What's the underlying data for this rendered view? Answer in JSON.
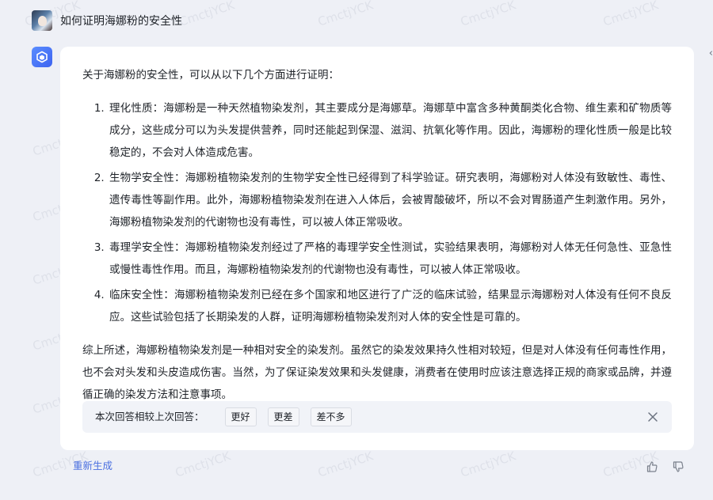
{
  "watermark": "CmctjYCK",
  "user": {
    "question": "如何证明海娜粉的安全性"
  },
  "answer": {
    "intro": "关于海娜粉的安全性，可以从以下几个方面进行证明：",
    "points": [
      "理化性质：海娜粉是一种天然植物染发剂，其主要成分是海娜草。海娜草中富含多种黄酮类化合物、维生素和矿物质等成分，这些成分可以为头发提供营养，同时还能起到保湿、滋润、抗氧化等作用。因此，海娜粉的理化性质一般是比较稳定的，不会对人体造成危害。",
      "生物学安全性：海娜粉植物染发剂的生物学安全性已经得到了科学验证。研究表明，海娜粉对人体没有致敏性、毒性、遗传毒性等副作用。此外，海娜粉植物染发剂在进入人体后，会被胃酸破坏，所以不会对胃肠道产生刺激作用。另外，海娜粉植物染发剂的代谢物也没有毒性，可以被人体正常吸收。",
      "毒理学安全性：海娜粉植物染发剂经过了严格的毒理学安全性测试，实验结果表明，海娜粉对人体无任何急性、亚急性或慢性毒性作用。而且，海娜粉植物染发剂的代谢物也没有毒性，可以被人体正常吸收。",
      "临床安全性：海娜粉植物染发剂已经在多个国家和地区进行了广泛的临床试验，结果显示海娜粉对人体没有任何不良反应。这些试验包括了长期染发的人群，证明海娜粉植物染发剂对人体的安全性是可靠的。"
    ],
    "summary": "综上所述，海娜粉植物染发剂是一种相对安全的染发剂。虽然它的染发效果持久性相对较短，但是对人体没有任何毒性作用，也不会对头发和头皮造成伤害。当然，为了保证染发效果和头发健康，消费者在使用时应该注意选择正规的商家或品牌，并遵循正确的染发方法和注意事项。"
  },
  "feedback": {
    "prompt": "本次回答相较上次回答：",
    "options": [
      "更好",
      "更差",
      "差不多"
    ]
  },
  "actions": {
    "regenerate": "重新生成"
  },
  "colors": {
    "accent": "#4a6fe0",
    "background": "#eef0f6",
    "card": "#ffffff"
  }
}
